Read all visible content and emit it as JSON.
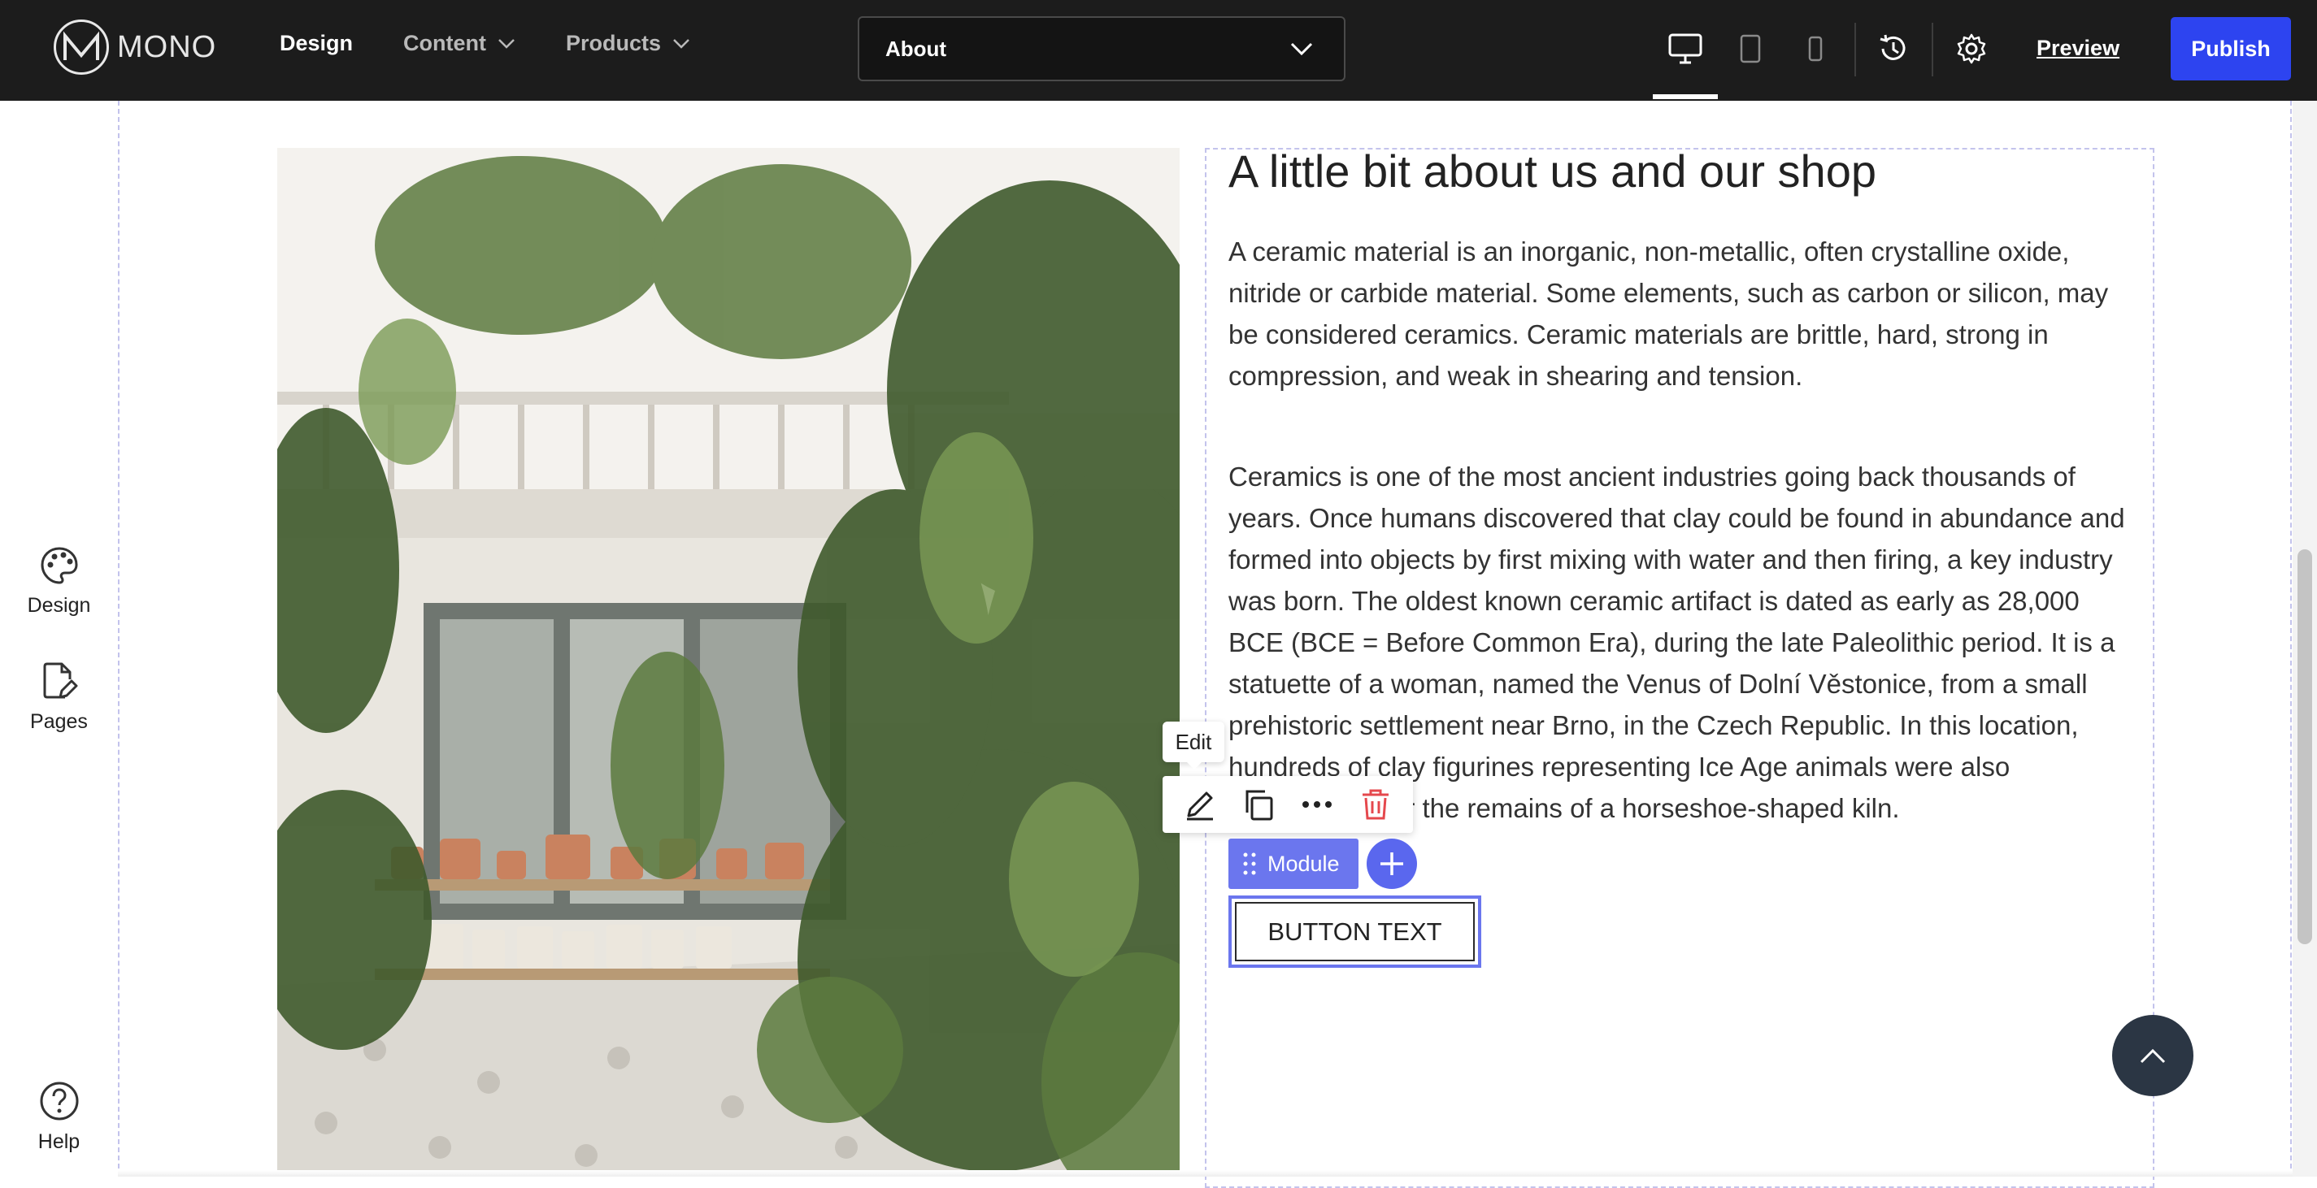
{
  "app": {
    "brand": "MONO",
    "nav": [
      {
        "label": "Design",
        "active": true,
        "has_dropdown": false
      },
      {
        "label": "Content",
        "active": false,
        "has_dropdown": true
      },
      {
        "label": "Products",
        "active": false,
        "has_dropdown": true
      }
    ],
    "page_selector": {
      "value": "About",
      "icon": "chevron-down-icon"
    },
    "devices": [
      {
        "name": "desktop-icon",
        "active": true
      },
      {
        "name": "tablet-icon",
        "active": false
      },
      {
        "name": "mobile-icon",
        "active": false
      }
    ],
    "history_icon": "history-icon",
    "settings_icon": "gear-icon",
    "preview_label": "Preview",
    "publish_label": "Publish",
    "accent_color": "#2d44f0"
  },
  "sidebar": {
    "items": [
      {
        "label": "Design",
        "icon": "palette-icon"
      },
      {
        "label": "Pages",
        "icon": "page-edit-icon"
      }
    ],
    "help": {
      "label": "Help",
      "icon": "help-icon"
    }
  },
  "content": {
    "heading": "A little bit about us and our shop",
    "paragraph_1": "A ceramic material is an inorganic, non-metallic, often crystalline oxide, nitride or carbide material. Some elements, such as carbon or silicon, may be considered ceramics. Ceramic materials are brittle, hard, strong in compression, and weak in shearing and tension.",
    "paragraph_2": "Ceramics is one of the most ancient industries going back thousands of years. Once humans discovered that clay could be found in abundance and formed into objects by first mixing with water and then firing, a key industry was born. The oldest known ceramic artifact is dated as early as 28,000 BCE (BCE = Before Common Era), during the late Paleolithic period. It is a statuette of a woman, named the Venus of Dolní Věstonice, from a small prehistoric settlement near Brno, in the Czech Republic. In this location, hundreds of clay figurines representing Ice Age animals were also uncovered near the remains of a horseshoe-shaped kiln.",
    "image_alt": "plant-shop-interior-photo",
    "button_text": "BUTTON TEXT"
  },
  "editor": {
    "tooltip": "Edit",
    "tools": [
      "pencil-icon",
      "duplicate-icon",
      "more-icon",
      "trash-icon"
    ],
    "module_label": "Module",
    "module_color": "#6b76ee",
    "delete_color": "#e5484d"
  },
  "scroll_top_icon": "arrow-up-icon"
}
